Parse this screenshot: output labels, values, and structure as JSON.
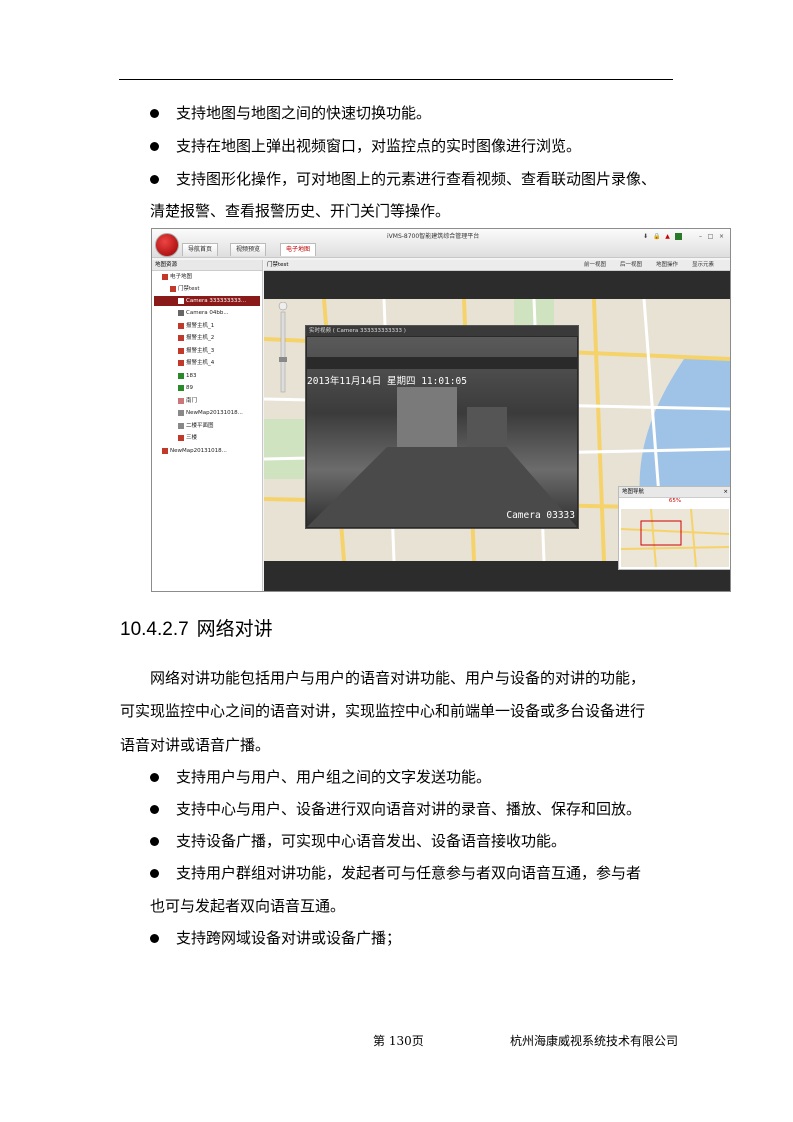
{
  "bullets_top": [
    "支持地图与地图之间的快速切换功能。",
    "支持在地图上弹出视频窗口，对监控点的实时图像进行浏览。",
    "支持图形化操作，可对地图上的元素进行查看视频、查看联动图片录像、"
  ],
  "bullet3_cont": "清楚报警、查看报警历史、开门关门等操作。",
  "screenshot": {
    "app_title": "iVMS-8700智能建筑综合管理平台",
    "tabs": [
      "导航首页",
      "视频预览",
      "电子地图"
    ],
    "tree_header": "地图资源",
    "tree_items": [
      "电子地图",
      "门禁test",
      "Camera 333333333...",
      "Camera 04bb...",
      "报警主机_1",
      "报警主机_2",
      "报警主机_3",
      "报警主机_4",
      "183",
      "89",
      "南门",
      "NewMap20131018...",
      "二楼平面图",
      "三楼",
      "NewMap20131018..."
    ],
    "map_tab": "门禁test",
    "toolbar": [
      "前一视图",
      "后一视图",
      "地图操作",
      "显示元素"
    ],
    "video_title": "实时视频 ( Camera 333333333333 )",
    "video_osd": "2013年11月14日  星期四  11:01:05",
    "video_cam": "Camera 03333",
    "nav_title": "地图导航",
    "nav_pct": "65%"
  },
  "heading": {
    "number": "10.4.2.7",
    "title": "网络对讲"
  },
  "paragraph": [
    "网络对讲功能包括用户与用户的语音对讲功能、用户与设备的对讲的功能，",
    "可实现监控中心之间的语音对讲，实现监控中心和前端单一设备或多台设备进行",
    "语音对讲或语音广播。"
  ],
  "bullets_bottom": [
    "支持用户与用户、用户组之间的文字发送功能。",
    "支持中心与用户、设备进行双向语音对讲的录音、播放、保存和回放。",
    "支持设备广播，可实现中心语音发出、设备语音接收功能。",
    "支持用户群组对讲功能，发起者可与任意参与者双向语音互通，参与者",
    "支持跨网域设备对讲或设备广播；"
  ],
  "bullet4_cont": "也可与发起者双向语音互通。",
  "footer": {
    "page": "第 130页",
    "company": "杭州海康威视系统技术有限公司"
  },
  "colors": {
    "accent": "#8a1a1a",
    "text": "#000000"
  }
}
